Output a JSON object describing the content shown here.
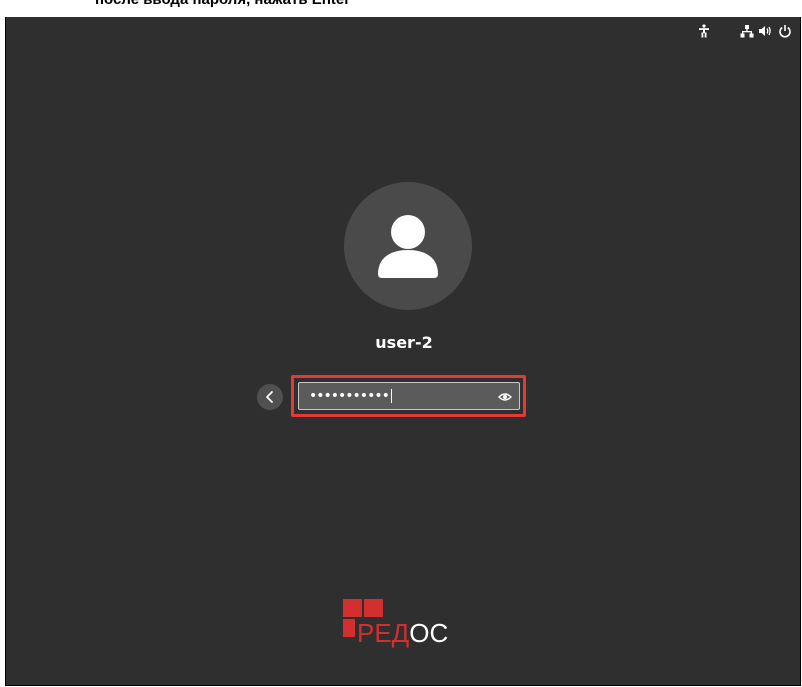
{
  "caption": {
    "text": "после ввода пароля, нажать Enter"
  },
  "topbar": {
    "icons": [
      "accessibility-icon",
      "network-icon",
      "volume-icon",
      "power-icon"
    ]
  },
  "login": {
    "username": "user-2",
    "password_masked": "•••••••••••",
    "back_icon": "chevron-left-icon",
    "reveal_icon": "eye-icon"
  },
  "logo": {
    "red_part": "РЕД",
    "white_part": "ОС"
  },
  "colors": {
    "background": "#2f2f2f",
    "highlight": "#e53935",
    "logo_red": "#d32f2f"
  }
}
